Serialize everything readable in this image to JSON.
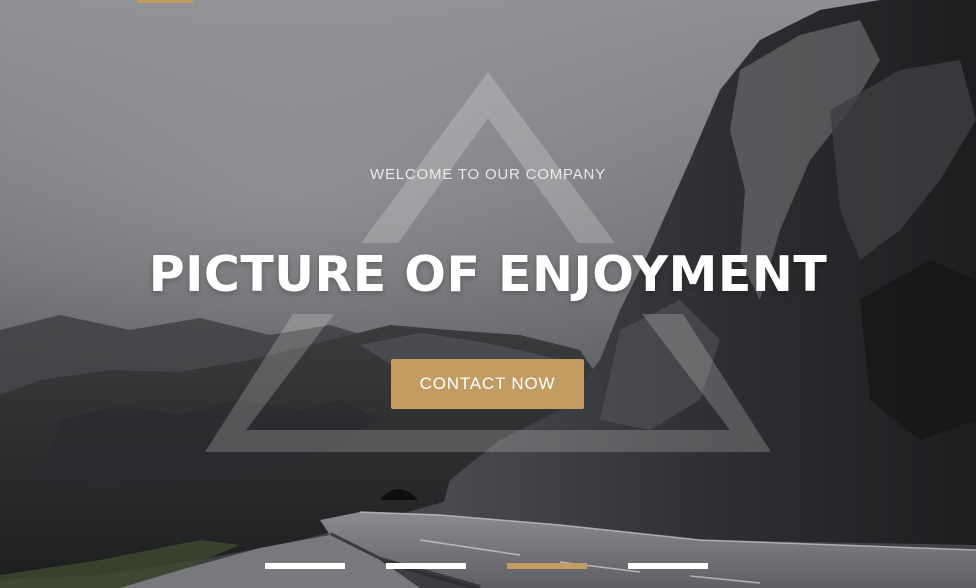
{
  "hero": {
    "kicker": "WELCOME TO OUR COMPANY",
    "title": "PICTURE OF ENJOYMENT",
    "cta_label": "CONTACT NOW"
  },
  "slider": {
    "slides": [
      "slide 1",
      "slide 2",
      "slide 3",
      "slide 4"
    ],
    "active_index": 2
  },
  "colors": {
    "accent": "#c29c62",
    "sky": "#5e5f62",
    "rock": "#232426",
    "road": "#6c6e71",
    "overlay": "#ffffff"
  },
  "icons": {
    "decor": "triangle-outline-icon"
  }
}
